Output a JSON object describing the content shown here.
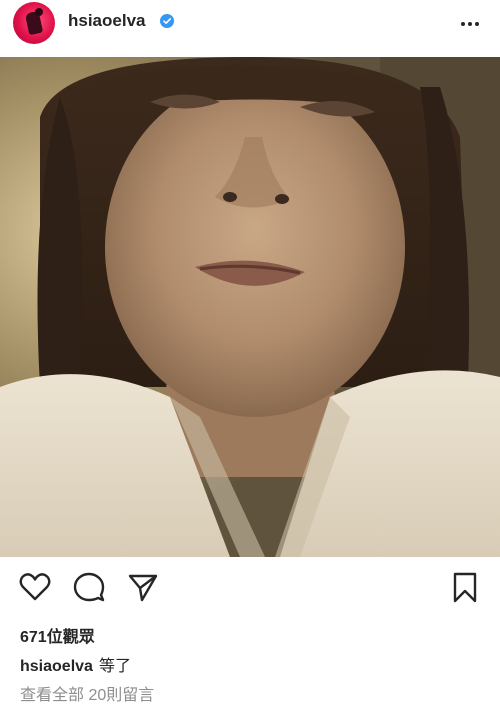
{
  "header": {
    "username": "hsiaoelva",
    "avatar": "profile-avatar",
    "verified_icon": "verified-badge-icon",
    "more_icon": "more-options-icon"
  },
  "media": {
    "type": "video-still",
    "description_icon": "post-video"
  },
  "actions": {
    "like_icon": "heart-icon",
    "comment_icon": "comment-icon",
    "share_icon": "send-icon",
    "save_icon": "bookmark-icon"
  },
  "stats": {
    "views": "671位觀眾"
  },
  "caption": {
    "username": "hsiaoelva",
    "text": "等了"
  },
  "comments": {
    "view_all": "查看全部 20則留言"
  },
  "colors": {
    "text": "#262626",
    "muted": "#8e8e8e",
    "verified": "#3897f0",
    "avatar_accent": "#e0114a"
  }
}
